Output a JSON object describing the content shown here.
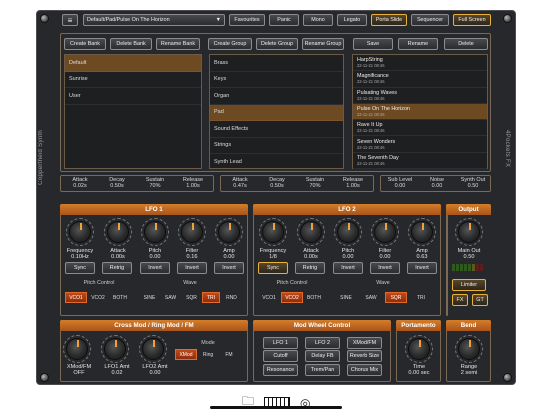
{
  "topbar": {
    "menu_icon": "hamburger-menu-icon",
    "preset": "Default/Pad/Pulse On The Horizon",
    "buttons": [
      "Favourites",
      "Panic",
      "Mono",
      "Legato",
      "Porta Slide",
      "Sequencer",
      "Full Screen"
    ]
  },
  "bankbar": {
    "left": [
      "Create Bank",
      "Delete Bank",
      "Rename Bank"
    ],
    "mid": [
      "Create Group",
      "Delete Group",
      "Rename Group"
    ],
    "right": [
      "Save",
      "Rename",
      "Delete"
    ]
  },
  "banks": [
    "Default",
    "Sunrise",
    "User"
  ],
  "groups": [
    "Brass",
    "Keys",
    "Organ",
    "Pad",
    "Sound Effects",
    "Strings",
    "Synth Lead"
  ],
  "presets": [
    {
      "name": "HarpString",
      "date": "22-11-21 08:46"
    },
    {
      "name": "Magnificance",
      "date": "22-11-21 08:46"
    },
    {
      "name": "Pulsating Waves",
      "date": "22-11-21 08:46"
    },
    {
      "name": "Pulse On The Horizon",
      "date": "22-11-21 08:46"
    },
    {
      "name": "Rave It Up",
      "date": "22-11-21 08:46"
    },
    {
      "name": "Seven Wonders",
      "date": "22-11-21 08:46"
    },
    {
      "name": "The Seventh Day",
      "date": "22-11-21 08:46"
    }
  ],
  "env1": [
    {
      "l": "Attack",
      "v": "0.02s"
    },
    {
      "l": "Decay",
      "v": "0.50s"
    },
    {
      "l": "Sustain",
      "v": "70%"
    },
    {
      "l": "Release",
      "v": "1.00s"
    }
  ],
  "env2": [
    {
      "l": "Attack",
      "v": "0.47s"
    },
    {
      "l": "Decay",
      "v": "0.50s"
    },
    {
      "l": "Sustain",
      "v": "70%"
    },
    {
      "l": "Release",
      "v": "1.00s"
    }
  ],
  "misc": [
    {
      "l": "Sub Level",
      "v": "0.00"
    },
    {
      "l": "Noise",
      "v": "0.00"
    },
    {
      "l": "Synth Out",
      "v": "0.50"
    }
  ],
  "side": {
    "left": "Coppertheid Synth",
    "right": "4Pockets FX"
  },
  "lfo1": {
    "title": "LFO 1",
    "knobs": [
      {
        "l": "Frequency",
        "v": "0.10Hz"
      },
      {
        "l": "Attack",
        "v": "0.00s"
      },
      {
        "l": "Pitch",
        "v": "0.00"
      },
      {
        "l": "Filter",
        "v": "0.16"
      },
      {
        "l": "Amp",
        "v": "0.00"
      }
    ],
    "buttons": [
      "Sync",
      "Retrig",
      "Invert",
      "Invert",
      "Invert"
    ],
    "pitch_label": "Pitch Control",
    "wave_label": "Wave",
    "pitch": [
      "VCO1",
      "VCO2",
      "BOTH"
    ],
    "wave": [
      "SINE",
      "SAW",
      "SQR",
      "TRI",
      "RND"
    ]
  },
  "lfo2": {
    "title": "LFO 2",
    "knobs": [
      {
        "l": "Frequency",
        "v": "1/8"
      },
      {
        "l": "Attack",
        "v": "0.00s"
      },
      {
        "l": "Pitch",
        "v": "0.00"
      },
      {
        "l": "Filter",
        "v": "0.00"
      },
      {
        "l": "Amp",
        "v": "0.63"
      }
    ],
    "buttons": [
      "Sync",
      "Retrig",
      "Invert",
      "Invert",
      "Invert"
    ],
    "pitch_label": "Pitch Control",
    "wave_label": "Wave",
    "pitch": [
      "VCO1",
      "VCO2",
      "BOTH"
    ],
    "wave": [
      "SINE",
      "SAW",
      "SQR",
      "TRI"
    ]
  },
  "output": {
    "title": "Output",
    "knob": {
      "l": "Main Out",
      "v": "0.50"
    },
    "limiter": "Limiter",
    "fx": "FX",
    "gt": "GT"
  },
  "crossmod": {
    "title": "Cross Mod / Ring Mod / FM",
    "knobs": [
      {
        "l": "XMod/FM",
        "v": "OFF"
      },
      {
        "l": "LFO1 Amt",
        "v": "0.02"
      },
      {
        "l": "LFO2 Amt",
        "v": "0.00"
      }
    ],
    "mode_label": "Mode",
    "modes": [
      "XMod",
      "Ring",
      "FM"
    ]
  },
  "modwheel": {
    "title": "Mod Wheel Control",
    "buttons": [
      "LFO 1",
      "LFO 2",
      "XMod/FM",
      "Cutoff",
      "Delay FB",
      "Reverb Size",
      "Resonance",
      "Trem/Pan",
      "Chorus Mix"
    ]
  },
  "portamento": {
    "title": "Portamento",
    "knob": {
      "l": "Time",
      "v": "0.00 sec"
    }
  },
  "bend": {
    "title": "Bend",
    "knob": {
      "l": "Range",
      "v": "2 semi"
    }
  },
  "dock": {
    "icons": [
      "folder-icon",
      "piano-icon",
      "palette-icon"
    ]
  }
}
